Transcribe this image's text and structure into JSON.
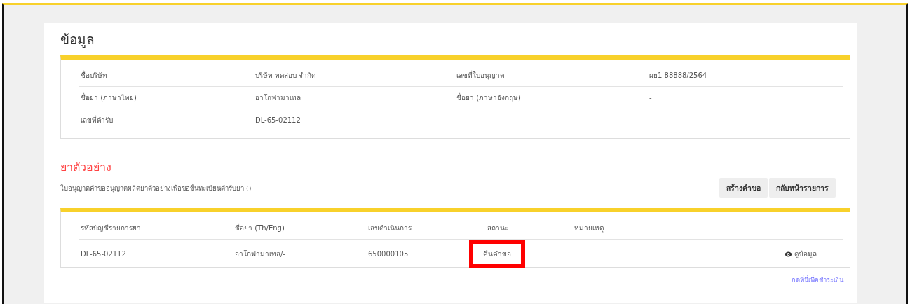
{
  "info": {
    "title": "ข้อมูล",
    "rows": [
      {
        "cells": [
          "ชื่อบริษัท",
          "บริษัท ทดสอบ จำกัด",
          "เลขที่ใบอนุญาต",
          "ผย1 88888/2564"
        ]
      },
      {
        "cells": [
          "ชื่อยา (ภาษาไทย)",
          "อาโกฟามาเทล",
          "ชื่อยา (ภาษาอังกฤษ)",
          "-"
        ]
      },
      {
        "cells": [
          "เลขที่ตำรับ",
          "DL-65-02112"
        ]
      }
    ]
  },
  "samples": {
    "title": "ยาตัวอย่าง",
    "description": "ใบอนุญาตคำขออนุญาตผลิตยาตัวอย่างเพื่อขอขึ้นทะเบียนตำรับยา ()",
    "buttons": [
      "สร้างคำขอ",
      "กลับหน้ารายการ"
    ],
    "table": {
      "columns": [
        "รหัสบัญชีรายการยา",
        "ชื่อยา (Th/Eng)",
        "เลขดำเนินการ",
        "สถานะ",
        "หมายเหตุ"
      ],
      "rows": [
        {
          "code": "DL-65-02112",
          "name": "อาโกฟามาเทล/-",
          "number": "650000105",
          "status": "คืนคำขอ",
          "status_highlighted": true,
          "action": "ดูข้อมูล"
        }
      ]
    },
    "pay_link": "กดที่นี่เพื่อชำระเงิน"
  }
}
